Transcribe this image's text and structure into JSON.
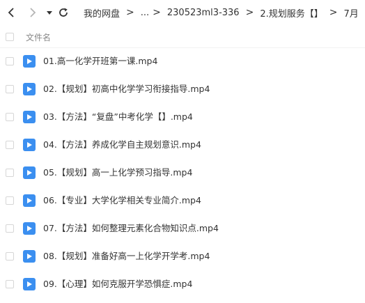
{
  "toolbar": {
    "back_icon": "chevron-left-icon",
    "forward_icon": "chevron-right-icon",
    "dropdown_icon": "caret-down-icon",
    "refresh_icon": "refresh-icon"
  },
  "breadcrumb": {
    "items": [
      "我的网盘",
      "...",
      "230523ml3-336",
      "2.规划服务【】",
      "7月"
    ],
    "separator": ">"
  },
  "table": {
    "header": "文件名",
    "files": [
      {
        "name": "01.高一化学开班第一课.mp4"
      },
      {
        "name": "02.【规划】初高中化学学习衔接指导.mp4"
      },
      {
        "name": "03.【方法】“复盘”中考化学【】.mp4"
      },
      {
        "name": "04.【方法】养成化学自主规划意识.mp4"
      },
      {
        "name": "05.【规划】高一上化学预习指导.mp4"
      },
      {
        "name": "06.【专业】大学化学相关专业简介.mp4"
      },
      {
        "name": "07.【方法】如何整理元素化合物知识点.mp4"
      },
      {
        "name": "08.【规划】准备好高一上化学开学考.mp4"
      },
      {
        "name": "09.【心理】如何克服开学恐惧症.mp4"
      }
    ]
  },
  "colors": {
    "video_icon": "#3b8ff0",
    "text": "#333333",
    "header_text": "#888888"
  }
}
